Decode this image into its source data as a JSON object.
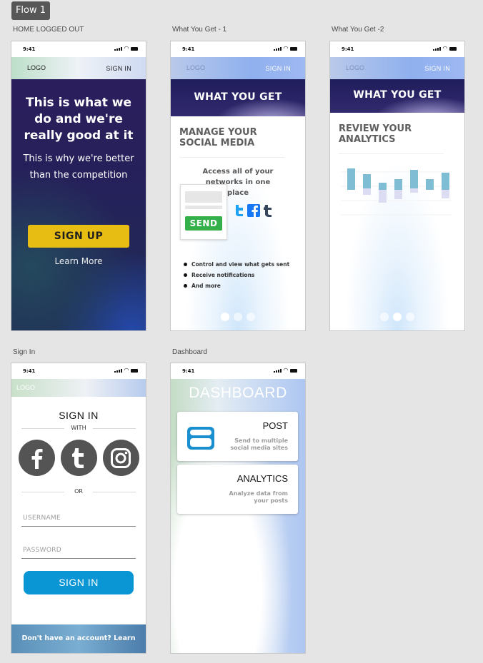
{
  "flow": {
    "label": "Flow 1"
  },
  "artboards": {
    "home": "HOME LOGGED OUT",
    "wyg1": "What You Get - 1",
    "wyg2": "What You Get -2",
    "signin": "Sign In",
    "dashboard": "Dashboard"
  },
  "status": {
    "time": "9:41"
  },
  "home": {
    "logo": "LOGO",
    "signin": "SIGN IN",
    "headline": "This is what we do and we're really good at it",
    "subhead": "This is why we're better than the competition",
    "cta": "SIGN UP",
    "learn_more": "Learn More"
  },
  "wyg1": {
    "logo": "LOGO",
    "signin": "SIGN IN",
    "banner": "WHAT YOU GET",
    "section": "MANAGE YOUR SOCIAL MEDIA",
    "sub": "Access all of your networks in one place",
    "send": "SEND",
    "bullets": [
      "Control and view what gets sent",
      "Receive notifications",
      "And more"
    ],
    "active_dot": 0
  },
  "wyg2": {
    "logo": "LOGO",
    "signin": "SIGN IN",
    "banner": "WHAT YOU GET",
    "section": "REVIEW YOUR ANALYTICS",
    "active_dot": 1
  },
  "signin": {
    "logo": "LOGO",
    "title": "SIGN IN",
    "with": "WITH",
    "or": "OR",
    "username": "USERNAME",
    "password": "PASSWORD",
    "button": "SIGN IN",
    "footer": "Don't have an account? Learn more"
  },
  "dashboard": {
    "title": "DASHBOARD",
    "post_title": "POST",
    "post_desc_1": "Send to multiple",
    "post_desc_2": "social media sites",
    "analytics_title": "ANALYTICS",
    "analytics_desc_1": "Analyze data from",
    "analytics_desc_2": "your posts"
  },
  "colors": {
    "cta_yellow": "#e7bd13",
    "signin_blue": "#0a96d4",
    "send_green": "#34b04a",
    "twitter": "#1da1f2",
    "facebook": "#1877f2",
    "tumblr": "#35465c",
    "post_icon": "#1a8fd0"
  },
  "icons": [
    "facebook-icon",
    "tumblr-icon",
    "instagram-icon",
    "twitter-icon",
    "post-icon"
  ]
}
